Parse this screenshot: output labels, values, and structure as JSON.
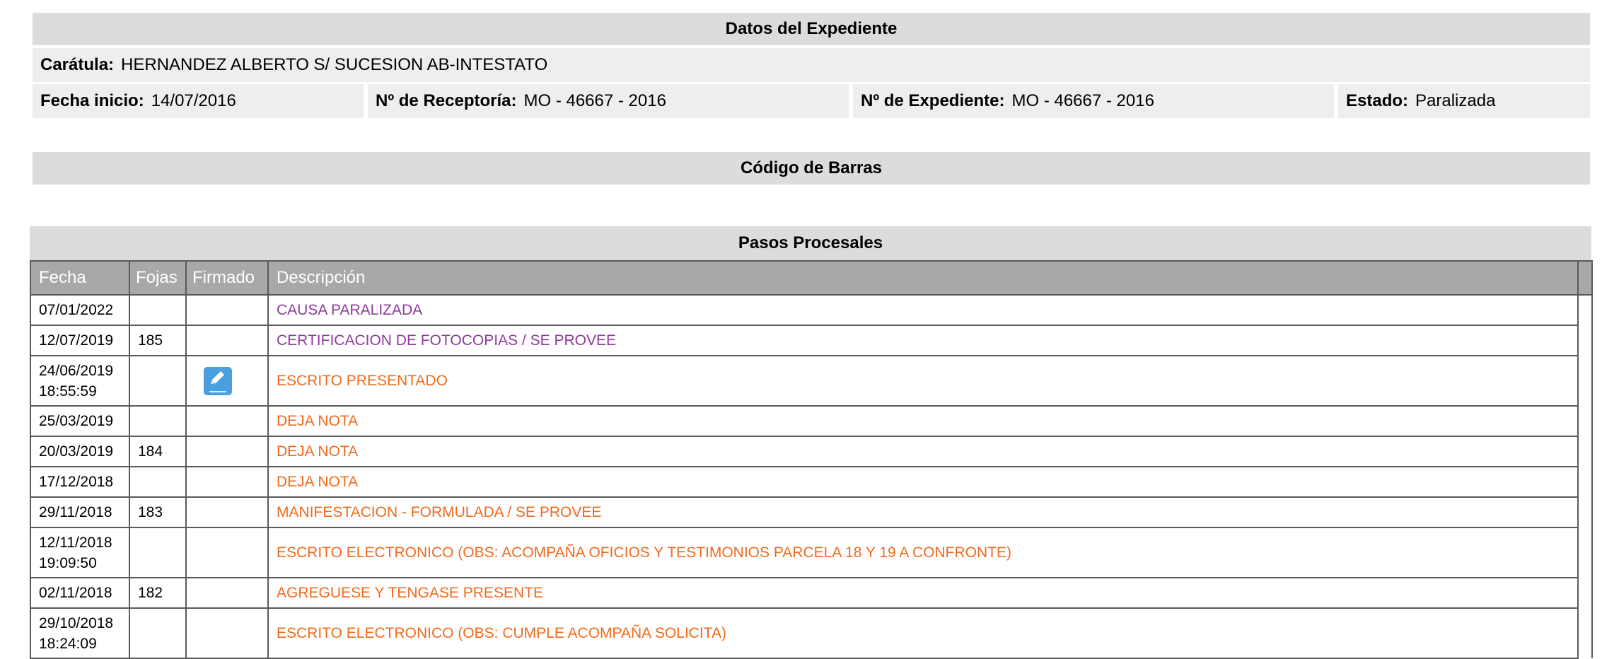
{
  "datos": {
    "title": "Datos del Expediente",
    "caratula_label": "Carátula:",
    "caratula_value": "HERNANDEZ ALBERTO S/ SUCESION AB-INTESTATO",
    "fecha_inicio_label": "Fecha inicio:",
    "fecha_inicio_value": "14/07/2016",
    "receptoria_label": "Nº de Receptoría:",
    "receptoria_value": "MO - 46667 - 2016",
    "expediente_label": "Nº de Expediente:",
    "expediente_value": "MO - 46667 - 2016",
    "estado_label": "Estado:",
    "estado_value": "Paralizada"
  },
  "codigo_barras": {
    "title": "Código de Barras"
  },
  "pasos": {
    "title": "Pasos Procesales",
    "columns": [
      "Fecha",
      "Fojas",
      "Firmado",
      "Descripción"
    ],
    "rows": [
      {
        "fecha": "07/01/2022",
        "hora": "",
        "fojas": "",
        "firmado": false,
        "descripcion": "CAUSA PARALIZADA",
        "color": "#8e3b9a"
      },
      {
        "fecha": "12/07/2019",
        "hora": "",
        "fojas": "185",
        "firmado": false,
        "descripcion": "CERTIFICACION DE FOTOCOPIAS / SE PROVEE",
        "color": "#8e3b9a"
      },
      {
        "fecha": "24/06/2019",
        "hora": "18:55:59",
        "fojas": "",
        "firmado": true,
        "descripcion": "ESCRITO PRESENTADO",
        "color": "#f06a1c"
      },
      {
        "fecha": "25/03/2019",
        "hora": "",
        "fojas": "",
        "firmado": false,
        "descripcion": "DEJA NOTA",
        "color": "#f06a1c"
      },
      {
        "fecha": "20/03/2019",
        "hora": "",
        "fojas": "184",
        "firmado": false,
        "descripcion": "DEJA NOTA",
        "color": "#f06a1c"
      },
      {
        "fecha": "17/12/2018",
        "hora": "",
        "fojas": "",
        "firmado": false,
        "descripcion": "DEJA NOTA",
        "color": "#f06a1c"
      },
      {
        "fecha": "29/11/2018",
        "hora": "",
        "fojas": "183",
        "firmado": false,
        "descripcion": "MANIFESTACION - FORMULADA / SE PROVEE",
        "color": "#f06a1c"
      },
      {
        "fecha": "12/11/2018",
        "hora": "19:09:50",
        "fojas": "",
        "firmado": false,
        "descripcion": "ESCRITO ELECTRONICO (OBS: ACOMPAÑA OFICIOS Y TESTIMONIOS PARCELA 18 Y 19 A CONFRONTE)",
        "color": "#f06a1c"
      },
      {
        "fecha": "02/11/2018",
        "hora": "",
        "fojas": "182",
        "firmado": false,
        "descripcion": "AGREGUESE Y TENGASE PRESENTE",
        "color": "#f06a1c"
      },
      {
        "fecha": "29/10/2018",
        "hora": "18:24:09",
        "fojas": "",
        "firmado": false,
        "descripcion": "ESCRITO ELECTRONICO (OBS: CUMPLE ACOMPAÑA SOLICITA)",
        "color": "#f06a1c"
      }
    ],
    "firmado_icon": "signed-pencil-icon"
  }
}
